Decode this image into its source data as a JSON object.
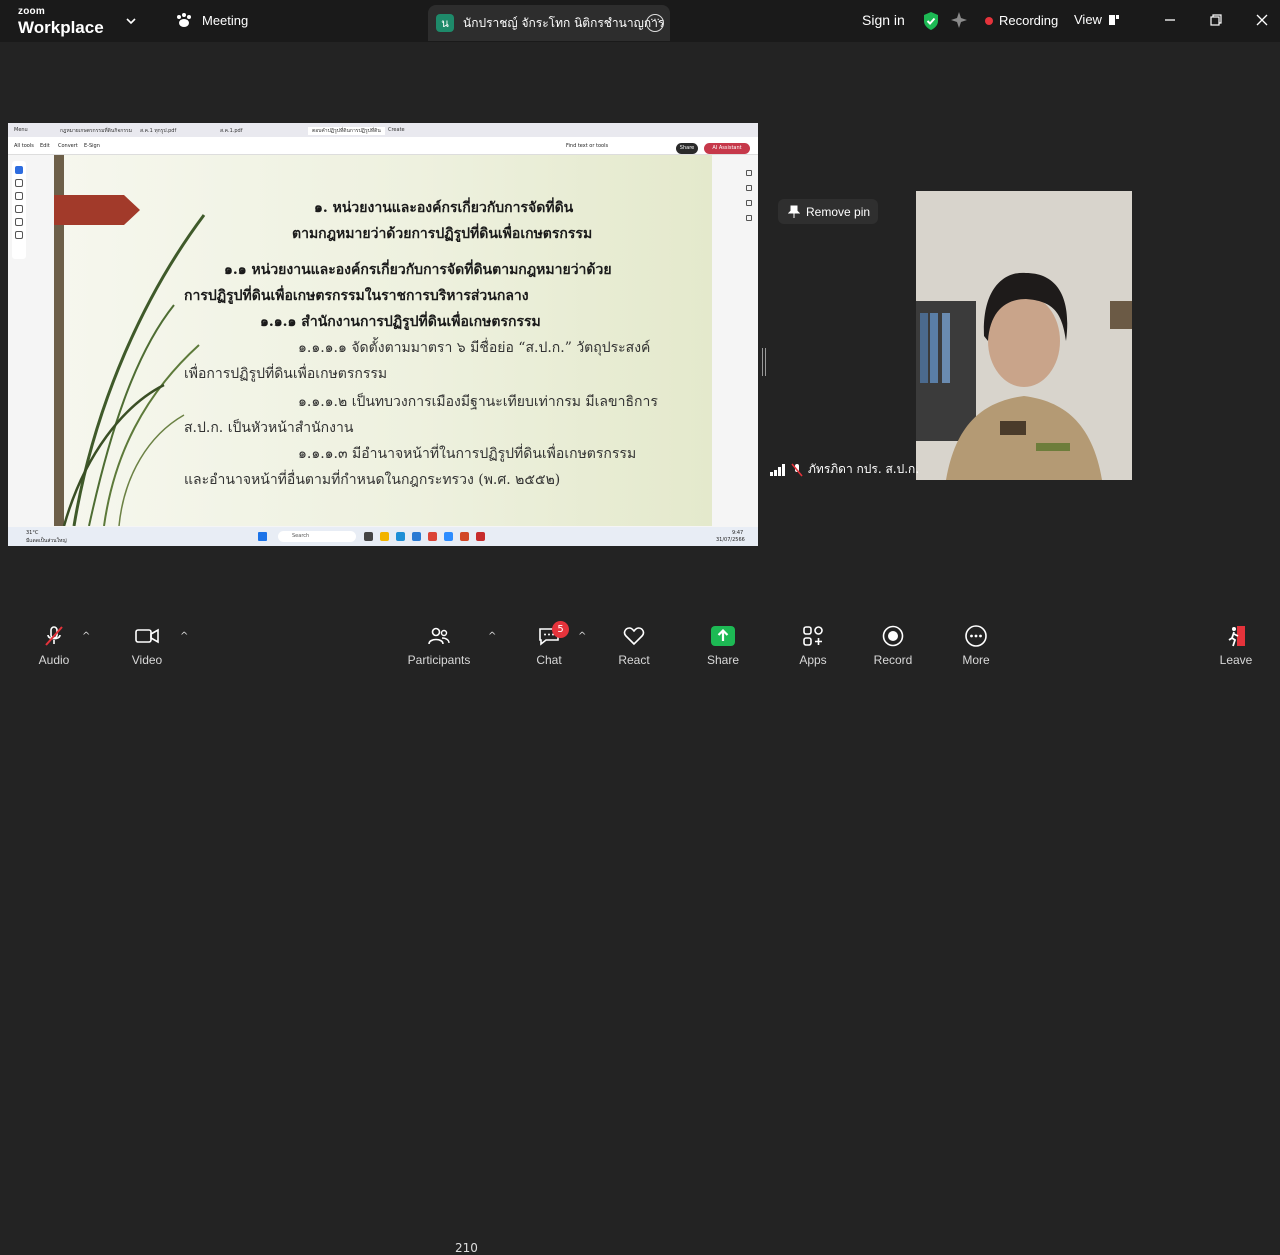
{
  "app": {
    "logo_small": "zoom",
    "logo_big": "Workplace",
    "meeting_label": "Meeting"
  },
  "speaker_tab": {
    "badge": "น",
    "name": "นักปราชญ์ จักระโทก นิติกรชำนาญการ"
  },
  "header": {
    "sign_in": "Sign in",
    "recording": "Recording",
    "view": "View"
  },
  "shared_screen": {
    "browser_tabs": [
      "Menu",
      "กฎหมายเกษตรกรรมที่ดินกิจกรรม",
      "ส.ค.1 ทุกรูป.pdf",
      "ส.ค.1.pdf",
      "ตอบคำปฏิรูปที่ดินการปฏิรูปที่ดิน",
      "Create"
    ],
    "acrobat_menu": [
      "All tools",
      "Edit",
      "Convert",
      "E-Sign"
    ],
    "find_label": "Find text or tools",
    "share_label": "Share",
    "ai_label": "AI Assistant",
    "taskbar": {
      "weather": "31°C",
      "weather_sub": "มีแดดเป็นส่วนใหญ่",
      "search": "Search",
      "clock": "9:47",
      "date": "31/07/2566"
    }
  },
  "slide": {
    "lines": [
      "๑. หน่วยงานและองค์กรเกี่ยวกับการจัดที่ดิน",
      "ตามกฎหมายว่าด้วยการปฏิรูปที่ดินเพื่อเกษตรกรรม",
      "๑.๑ หน่วยงานและองค์กรเกี่ยวกับการจัดที่ดินตามกฎหมายว่าด้วย",
      "การปฏิรูปที่ดินเพื่อเกษตรกรรมในราชการบริหารส่วนกลาง",
      "๑.๑.๑ สำนักงานการปฏิรูปที่ดินเพื่อเกษตรกรรม",
      "๑.๑.๑.๑ จัดตั้งตามมาตรา ๖ มีชื่อย่อ “ส.ป.ก.” วัตถุประสงค์",
      "เพื่อการปฏิรูปที่ดินเพื่อเกษตรกรรม",
      "๑.๑.๑.๒ เป็นทบวงการเมืองมีฐานะเทียบเท่ากรม มีเลขาธิการ",
      "ส.ป.ก. เป็นหัวหน้าสำนักงาน",
      "๑.๑.๑.๓ มีอำนาจหน้าที่ในการปฏิรูปที่ดินเพื่อเกษตรกรรม",
      "และอำนาจหน้าที่อื่นตามที่กำหนดในกฎกระทรวง (พ.ศ. ๒๕๕๒)"
    ]
  },
  "pinned": {
    "remove_pin": "Remove pin",
    "participant_name": "ภัทรภิดา กปร. ส.ป.ก."
  },
  "toolbar": {
    "audio": "Audio",
    "video": "Video",
    "participants": "Participants",
    "participants_count": "210",
    "chat": "Chat",
    "chat_badge": "5",
    "react": "React",
    "share": "Share",
    "apps": "Apps",
    "record": "Record",
    "more": "More",
    "leave": "Leave"
  },
  "colors": {
    "accent_green": "#1db954",
    "recording_red": "#e5333b",
    "leave_red": "#e5333b"
  }
}
